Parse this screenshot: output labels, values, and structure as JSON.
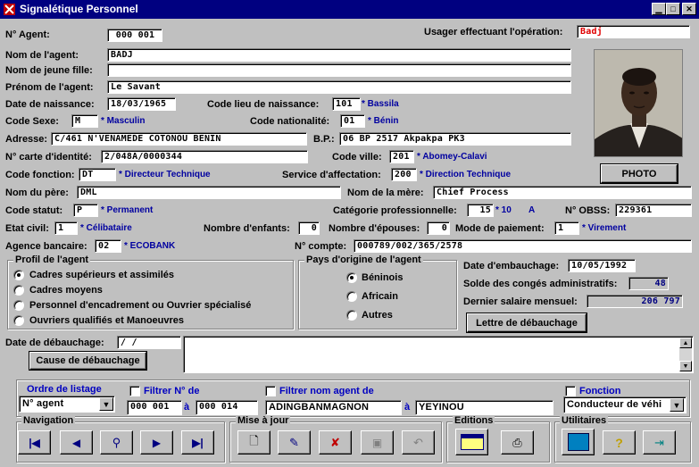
{
  "window": {
    "title": "Signalétique Personnel"
  },
  "header": {
    "agent_no_label": "N° Agent:",
    "agent_no": "000 001",
    "user_label": "Usager effectuant l'opération:",
    "user": "Badj"
  },
  "identity": {
    "nom_label": "Nom de l'agent:",
    "nom": "BADJ",
    "jeune_fille_label": "Nom de jeune fille:",
    "jeune_fille": "",
    "prenom_label": "Prénom de l'agent:",
    "prenom": "Le Savant",
    "naissance_label": "Date de naissance:",
    "naissance": "18/03/1965",
    "lieu_label": "Code lieu de naissance:",
    "lieu_code": "101",
    "lieu_desc": "Bassila",
    "sexe_label": "Code Sexe:",
    "sexe_code": "M",
    "sexe_desc": "Masculin",
    "nationalite_label": "Code nationalité:",
    "nationalite_code": "01",
    "nationalite_desc": "Bénin",
    "adresse_label": "Adresse:",
    "adresse": "C/461 N'VENAMEDE COTONOU BENIN",
    "bp_label": "B.P.:",
    "bp": "06 BP 2517 Akpakpa PK3",
    "carte_label": "N° carte d'identité:",
    "carte": "2/048A/0000344",
    "ville_label": "Code ville:",
    "ville_code": "201",
    "ville_desc": "Abomey-Calavi",
    "fonction_label": "Code fonction:",
    "fonction_code": "DT",
    "fonction_desc": "Directeur Technique",
    "service_label": "Service d'affectation:",
    "service_code": "200",
    "service_desc": "Direction Technique",
    "pere_label": "Nom du père:",
    "pere": "DML",
    "mere_label": "Nom de la mère:",
    "mere": "Chief Process",
    "statut_label": "Code statut:",
    "statut_code": "P",
    "statut_desc": "Permanent",
    "categorie_label": "Catégorie professionnelle:",
    "categorie_code": "15",
    "categorie_desc1": "10",
    "categorie_desc2": "A",
    "obss_label": "N° OBSS:",
    "obss": "229361",
    "civil_label": "Etat civil:",
    "civil_code": "1",
    "civil_desc": "Célibataire",
    "enfants_label": "Nombre d'enfants:",
    "enfants": "0",
    "epouses_label": "Nombre d'épouses:",
    "epouses": "0",
    "paiement_label": "Mode de paiement:",
    "paiement_code": "1",
    "paiement_desc": "Virement",
    "banque_label": "Agence bancaire:",
    "banque_code": "02",
    "banque_desc": "ECOBANK",
    "compte_label": "N° compte:",
    "compte": "000789/002/365/2578"
  },
  "photo_button": "PHOTO",
  "profil": {
    "title": "Profil de l'agent",
    "options": [
      "Cadres supérieurs et assimilés",
      "Cadres moyens",
      "Personnel d'encadrement ou Ouvrier spécialisé",
      "Ouvriers qualifiés et Manoeuvres"
    ]
  },
  "pays": {
    "title": "Pays d'origine de l'agent",
    "options": [
      "Béninois",
      "Africain",
      "Autres"
    ]
  },
  "emploi": {
    "embauchage_label": "Date d'embauchage:",
    "embauchage": "10/05/1992",
    "conges_label": "Solde des congés administratifs:",
    "conges": "48",
    "salaire_label": "Dernier salaire mensuel:",
    "salaire": "206 797",
    "lettre_button": "Lettre de débauchage",
    "debauchage_label": "Date de débauchage:",
    "debauchage": "/ /",
    "cause_button": "Cause de débauchage"
  },
  "filters": {
    "ordre_label": "Ordre de listage",
    "ordre_value": "N° agent",
    "filtre_no_label": "Filtrer N° de",
    "no_from": "000 001",
    "a1": "à",
    "no_to": "000 014",
    "filtre_nom_label": "Filtrer nom agent de",
    "nom_from": "ADINGBANMAGNON",
    "a2": "à",
    "nom_to": "YEYINOU",
    "fonction_label": "Fonction",
    "fonction_value": "Conducteur de véhi"
  },
  "toolbar": {
    "navigation": "Navigation",
    "mise_a_jour": "Mise à jour",
    "editions": "Editions",
    "utilitaires": "Utilitaires"
  },
  "colors": {
    "titlebar": "#000080",
    "face": "#c0c0c0",
    "desc": "#0000a0",
    "user": "#e00000"
  }
}
